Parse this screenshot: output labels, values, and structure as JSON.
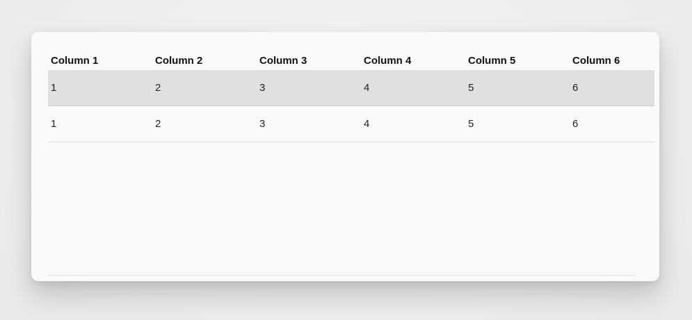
{
  "table": {
    "columns": [
      "Column 1",
      "Column 2",
      "Column 3",
      "Column 4",
      "Column 5",
      "Column 6"
    ],
    "rows": [
      [
        "1",
        "2",
        "3",
        "4",
        "5",
        "6"
      ],
      [
        "1",
        "2",
        "3",
        "4",
        "5",
        "6"
      ]
    ],
    "highlighted_row_color": "#e0e0e0",
    "background_color": "#fafafa"
  }
}
